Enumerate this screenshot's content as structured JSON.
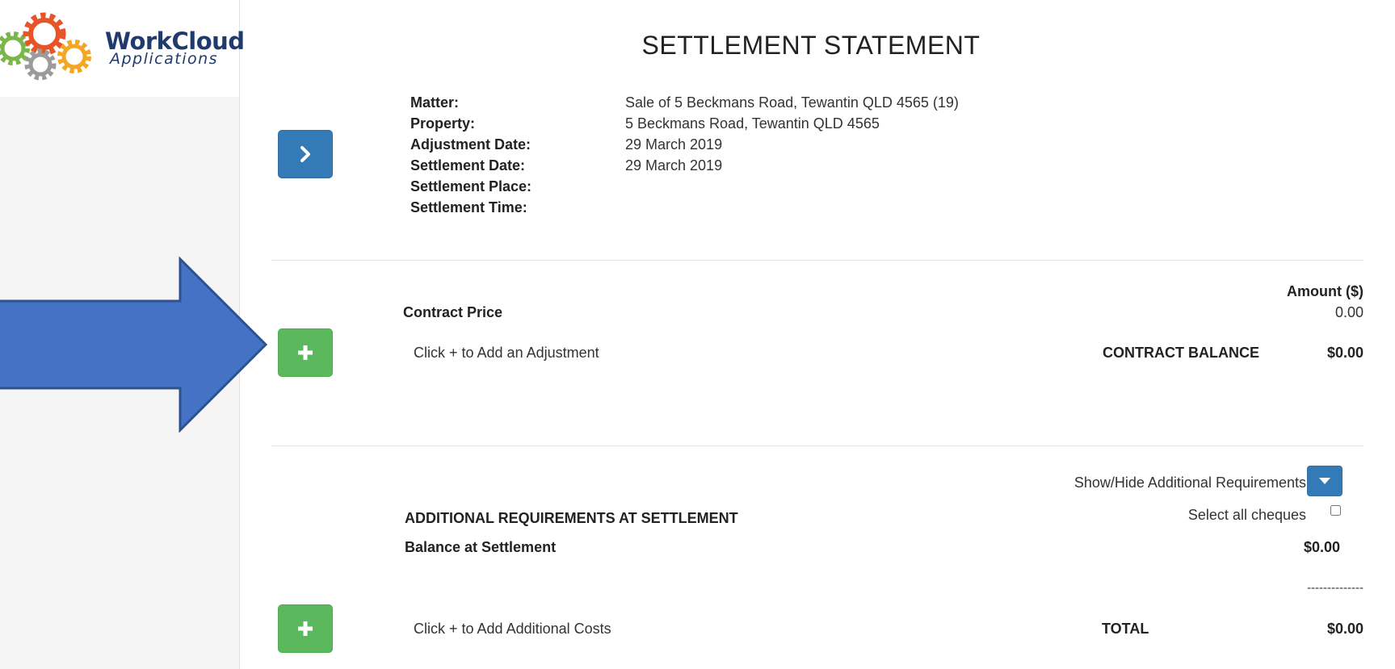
{
  "logo": {
    "line1": "WorkCloud",
    "line2": "Applications"
  },
  "title": "SETTLEMENT STATEMENT",
  "details": [
    {
      "label": "Matter:",
      "value": "Sale of 5 Beckmans Road, Tewantin QLD 4565 (19)"
    },
    {
      "label": "Property:",
      "value": "5 Beckmans Road, Tewantin QLD 4565"
    },
    {
      "label": "Adjustment Date:",
      "value": "29 March 2019"
    },
    {
      "label": "Settlement Date:",
      "value": "29 March 2019"
    },
    {
      "label": "Settlement Place:",
      "value": ""
    },
    {
      "label": "Settlement Time:",
      "value": ""
    }
  ],
  "contract": {
    "amount_header": "Amount ($)",
    "price_label": "Contract Price",
    "price_value": "0.00",
    "add_hint": "Click + to Add an Adjustment",
    "balance_label": "CONTRACT BALANCE",
    "balance_value": "$0.00"
  },
  "additional": {
    "toggle_label": "Show/Hide Additional Requirements",
    "heading": "ADDITIONAL REQUIREMENTS AT SETTLEMENT",
    "select_cheques_label": "Select all cheques",
    "balance_label": "Balance at Settlement",
    "balance_value": "$0.00",
    "separator": "--------------",
    "add_hint": "Click + to Add Additional Costs",
    "total_label": "TOTAL",
    "total_value": "$0.00"
  },
  "icons": {
    "next": "chevron-right-icon",
    "add": "plus-icon",
    "toggle": "caret-down-icon"
  },
  "colors": {
    "primary_blue": "#337ab7",
    "success_green": "#5cb85c",
    "annotation_arrow": "#4472c4",
    "logo_navy": "#1f3a6b"
  }
}
